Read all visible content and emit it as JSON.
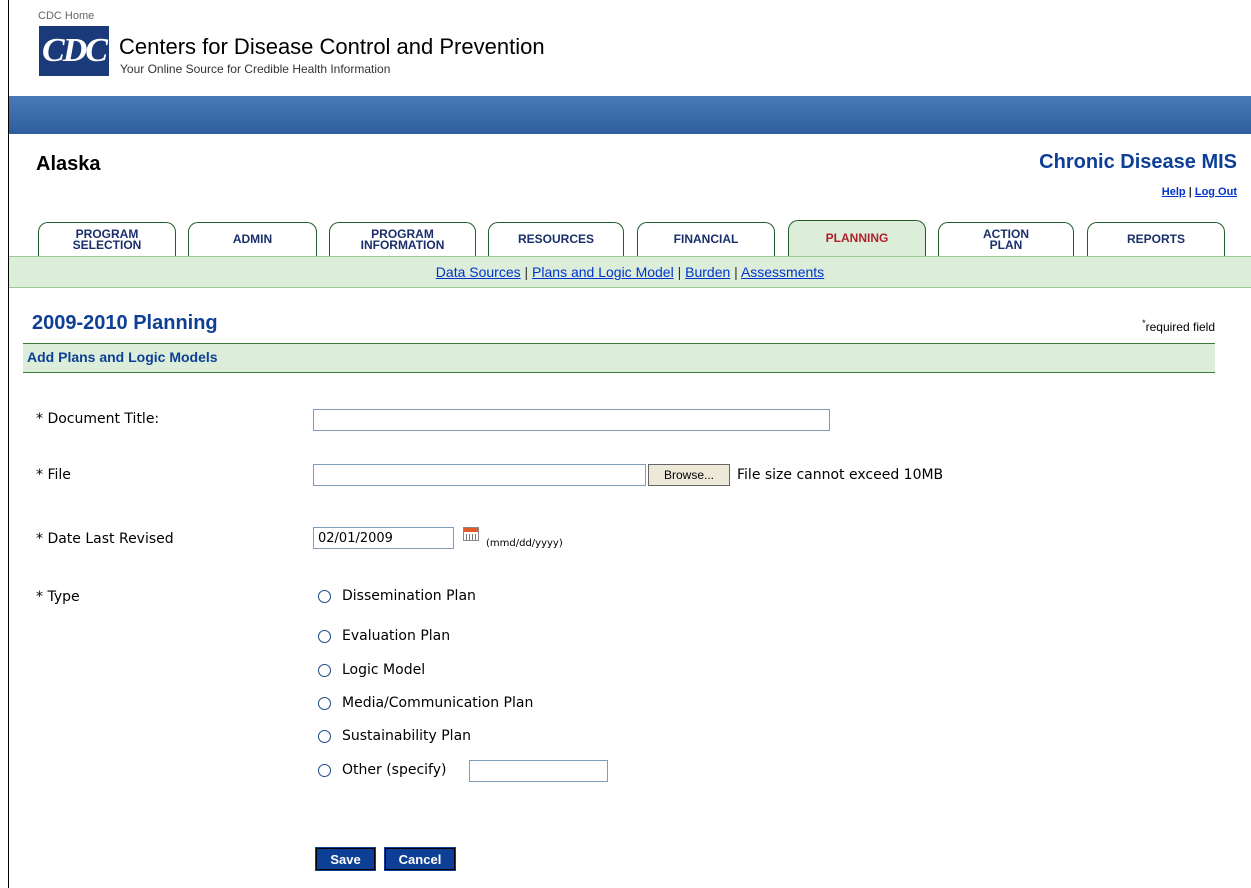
{
  "header": {
    "cdc_home": "CDC Home",
    "logo_text": "CDC",
    "title": "Centers for Disease Control and Prevention",
    "tagline": "Your Online Source for Credible Health Information"
  },
  "context": {
    "state": "Alaska",
    "app_name": "Chronic Disease MIS",
    "help": "Help",
    "separator": "|",
    "logout": "Log Out"
  },
  "tabs": [
    {
      "line1": "PROGRAM",
      "line2": "SELECTION",
      "active": false
    },
    {
      "line1": "ADMIN",
      "line2": "",
      "active": false
    },
    {
      "line1": "PROGRAM",
      "line2": "INFORMATION",
      "active": false
    },
    {
      "line1": "RESOURCES",
      "line2": "",
      "active": false
    },
    {
      "line1": "FINANCIAL",
      "line2": "",
      "active": false
    },
    {
      "line1": "PLANNING",
      "line2": "",
      "active": true
    },
    {
      "line1": "ACTION",
      "line2": "PLAN",
      "active": false
    },
    {
      "line1": "REPORTS",
      "line2": "",
      "active": false
    }
  ],
  "subnav": {
    "items": [
      "Data Sources",
      "Plans and Logic Model",
      "Burden",
      "Assessments"
    ],
    "separator": "|"
  },
  "page": {
    "title": "2009-2010 Planning",
    "required_marker": "*",
    "required_note": "required field",
    "section": "Add Plans and Logic Models"
  },
  "form": {
    "doc_title_label": "* Document Title:",
    "doc_title_value": "",
    "file_label": "* File",
    "file_value": "",
    "browse_label": "Browse...",
    "file_hint": "File size cannot exceed 10MB",
    "date_label": "* Date Last Revised",
    "date_value": "02/01/2009",
    "date_hint": "(mmd/dd/yyyy)",
    "type_label": "* Type",
    "types": [
      "Dissemination Plan",
      "Evaluation Plan",
      "Logic Model",
      "Media/Communication Plan",
      "Sustainability Plan",
      "Other (specify)"
    ],
    "other_value": "",
    "save_label": "Save",
    "cancel_label": "Cancel"
  },
  "colors": {
    "brand_blue": "#0e3f96",
    "band_blue": "#2e5e9c",
    "active_tab_text": "#b0202b",
    "nav_green": "#dceeda"
  }
}
